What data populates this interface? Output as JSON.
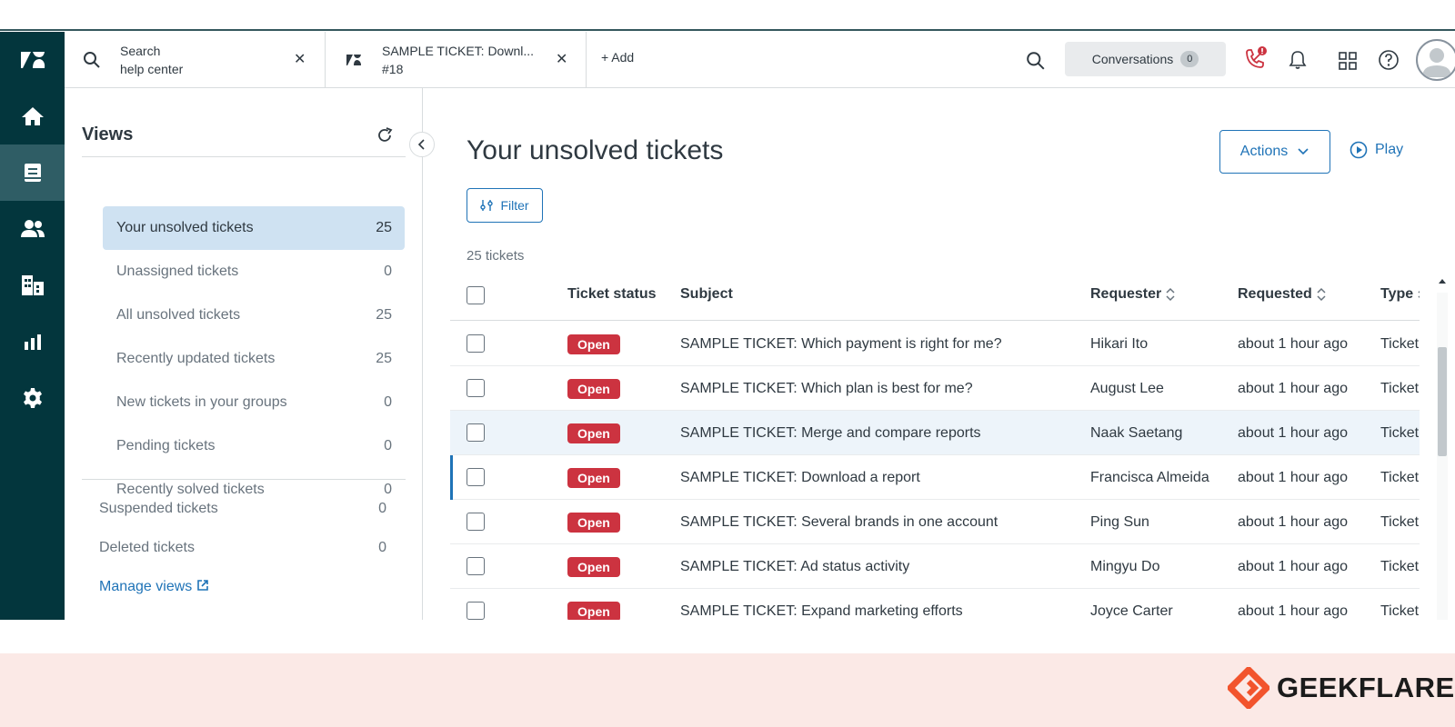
{
  "header": {
    "tabs": [
      {
        "line1": "Search",
        "line2": "help center"
      },
      {
        "line1": "SAMPLE TICKET: Downl...",
        "line2": "#18"
      }
    ],
    "add_label": "+ Add",
    "conversations_label": "Conversations",
    "conversations_count": "0"
  },
  "views": {
    "title": "Views",
    "items": [
      {
        "label": "Your unsolved tickets",
        "count": "25"
      },
      {
        "label": "Unassigned tickets",
        "count": "0"
      },
      {
        "label": "All unsolved tickets",
        "count": "25"
      },
      {
        "label": "Recently updated tickets",
        "count": "25"
      },
      {
        "label": "New tickets in your groups",
        "count": "0"
      },
      {
        "label": "Pending tickets",
        "count": "0"
      },
      {
        "label": "Recently solved tickets",
        "count": "0"
      }
    ],
    "secondary": [
      {
        "label": "Suspended tickets",
        "count": "0"
      },
      {
        "label": "Deleted tickets",
        "count": "0"
      }
    ],
    "manage_label": "Manage views"
  },
  "main": {
    "title": "Your unsolved tickets",
    "actions_label": "Actions",
    "play_label": "Play",
    "filter_label": "Filter",
    "count_label": "25 tickets",
    "columns": {
      "status": "Ticket status",
      "subject": "Subject",
      "requester": "Requester",
      "requested": "Requested",
      "type": "Type"
    },
    "rows": [
      {
        "status": "Open",
        "subject": "SAMPLE TICKET: Which payment is right for me?",
        "requester": "Hikari Ito",
        "requested": "about 1 hour ago",
        "type": "Ticket"
      },
      {
        "status": "Open",
        "subject": "SAMPLE TICKET: Which plan is best for me?",
        "requester": "August Lee",
        "requested": "about 1 hour ago",
        "type": "Ticket"
      },
      {
        "status": "Open",
        "subject": "SAMPLE TICKET: Merge and compare reports",
        "requester": "Naak Saetang",
        "requested": "about 1 hour ago",
        "type": "Ticket"
      },
      {
        "status": "Open",
        "subject": "SAMPLE TICKET: Download a report",
        "requester": "Francisca Almeida",
        "requested": "about 1 hour ago",
        "type": "Ticket"
      },
      {
        "status": "Open",
        "subject": "SAMPLE TICKET: Several brands in one account",
        "requester": "Ping Sun",
        "requested": "about 1 hour ago",
        "type": "Ticket"
      },
      {
        "status": "Open",
        "subject": "SAMPLE TICKET: Ad status activity",
        "requester": "Mingyu Do",
        "requested": "about 1 hour ago",
        "type": "Ticket"
      },
      {
        "status": "Open",
        "subject": "SAMPLE TICKET: Expand marketing efforts",
        "requester": "Joyce Carter",
        "requested": "about 1 hour ago",
        "type": "Ticket"
      }
    ]
  },
  "footer": {
    "brand": "GEEKFLARE"
  },
  "colors": {
    "rail": "#03363d",
    "accent": "#1f73b7",
    "open_badge": "#cc3340",
    "footer": "#fbe9e6"
  }
}
